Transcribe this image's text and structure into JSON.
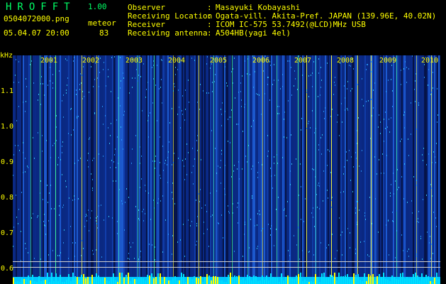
{
  "app": {
    "title": "HROFFT",
    "version": "1.00"
  },
  "file": {
    "name": "0504072000.png",
    "datetime": "05.04.07 20:00"
  },
  "mode": {
    "label": "meteor",
    "value": "83"
  },
  "info": [
    {
      "label": "Observer",
      "value": "Masayuki Kobayashi"
    },
    {
      "label": "Receiving Location",
      "value": "Ogata-vill. Akita-Pref. JAPAN (139.96E, 40.02N)"
    },
    {
      "label": "Receiver",
      "value": "ICOM IC-575 53.7492(@LCD)MHz USB"
    },
    {
      "label": "Receiving antenna",
      "value": "A504HB(yagi 4el)"
    }
  ],
  "colon": ":",
  "axis": {
    "unit": "kHz",
    "y_ticks": [
      "1.1",
      "1.0",
      "0.9",
      "0.8",
      "0.7",
      "0.6"
    ],
    "x_ticks": [
      "2001",
      "2002",
      "2003",
      "2004",
      "2005",
      "2006",
      "2007",
      "2008",
      "2009",
      "2010"
    ]
  },
  "colors": {
    "yellow": "#ffff00",
    "green": "#00ff66",
    "white": "#ffffff",
    "background": "#000000"
  }
}
